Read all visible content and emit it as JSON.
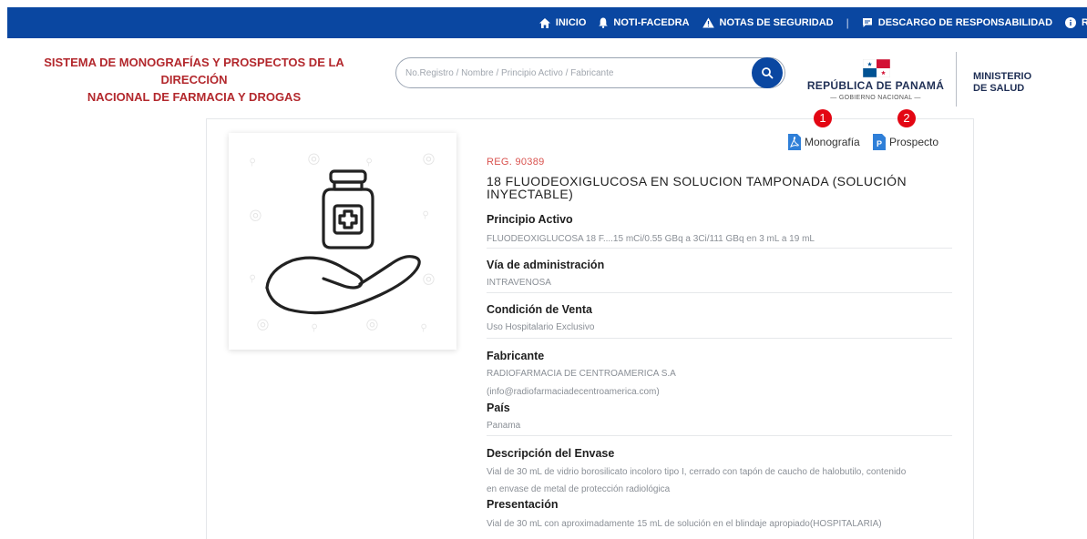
{
  "nav": {
    "inicio": "INICIO",
    "noti": "NOTI-FACEDRA",
    "notas": "NOTAS DE SEGURIDAD",
    "separator": "|",
    "descargo": "DESCARGO DE RESPONSABILIDAD",
    "last_partial": "R"
  },
  "header": {
    "system_title_line1": "SISTEMA DE MONOGRAFÍAS Y PROSPECTOS DE LA DIRECCIÓN",
    "system_title_line2": "NACIONAL DE FARMACIA Y DROGAS",
    "search_placeholder": "No.Registro / Nombre / Principio Activo / Fabricante",
    "republica": "REPÚBLICA DE PANAMÁ",
    "gobierno": "— GOBIERNO NACIONAL —",
    "ministerio_line1": "MINISTERIO",
    "ministerio_line2": "DE SALUD"
  },
  "documents": [
    {
      "badge": "1",
      "label": "Monografía",
      "icon": "pdf-icon"
    },
    {
      "badge": "2",
      "label": "Prospecto",
      "icon": "prospecto-icon",
      "icon_letter": "P"
    }
  ],
  "product": {
    "reg": "REG. 90389",
    "name_line1": "18 FLUODEOXIGLUCOSA EN SOLUCION TAMPONADA (SOLUCIÓN",
    "name_line2": "INYECTABLE)",
    "fields": {
      "principio_label": "Principio Activo",
      "principio_value": "FLUODEOXIGLUCOSA 18 F....15 mCi/0.55 GBq a 3Ci/111 GBq en 3 mL a 19 mL",
      "via_label": "Vía de administración",
      "via_value": "INTRAVENOSA",
      "condicion_label": "Condición de Venta",
      "condicion_value": "Uso Hospitalario Exclusivo",
      "fabricante_label": "Fabricante",
      "fabricante_value1": "RADIOFARMACIA DE CENTROAMERICA S.A",
      "fabricante_value2": "(info@radiofarmaciadecentroamerica.com)",
      "pais_label": "País",
      "pais_value": "Panama",
      "envase_label": "Descripción del Envase",
      "envase_value1": "Vial de 30 mL de vidrio borosilicato incoloro tipo I, cerrado con tapón de caucho de halobutilo, contenido",
      "envase_value2": "en envase de metal de protección radiológica",
      "presentacion_label": "Presentación",
      "presentacion_value": "Vial de 30 mL con aproximadamente 15 mL de solución en el blindaje apropiado(HOSPITALARIA)"
    }
  },
  "colors": {
    "nav_blue": "#0A47A1",
    "title_red": "#B3282D",
    "badge_red": "#E30613",
    "reg_red": "#D9534F"
  }
}
